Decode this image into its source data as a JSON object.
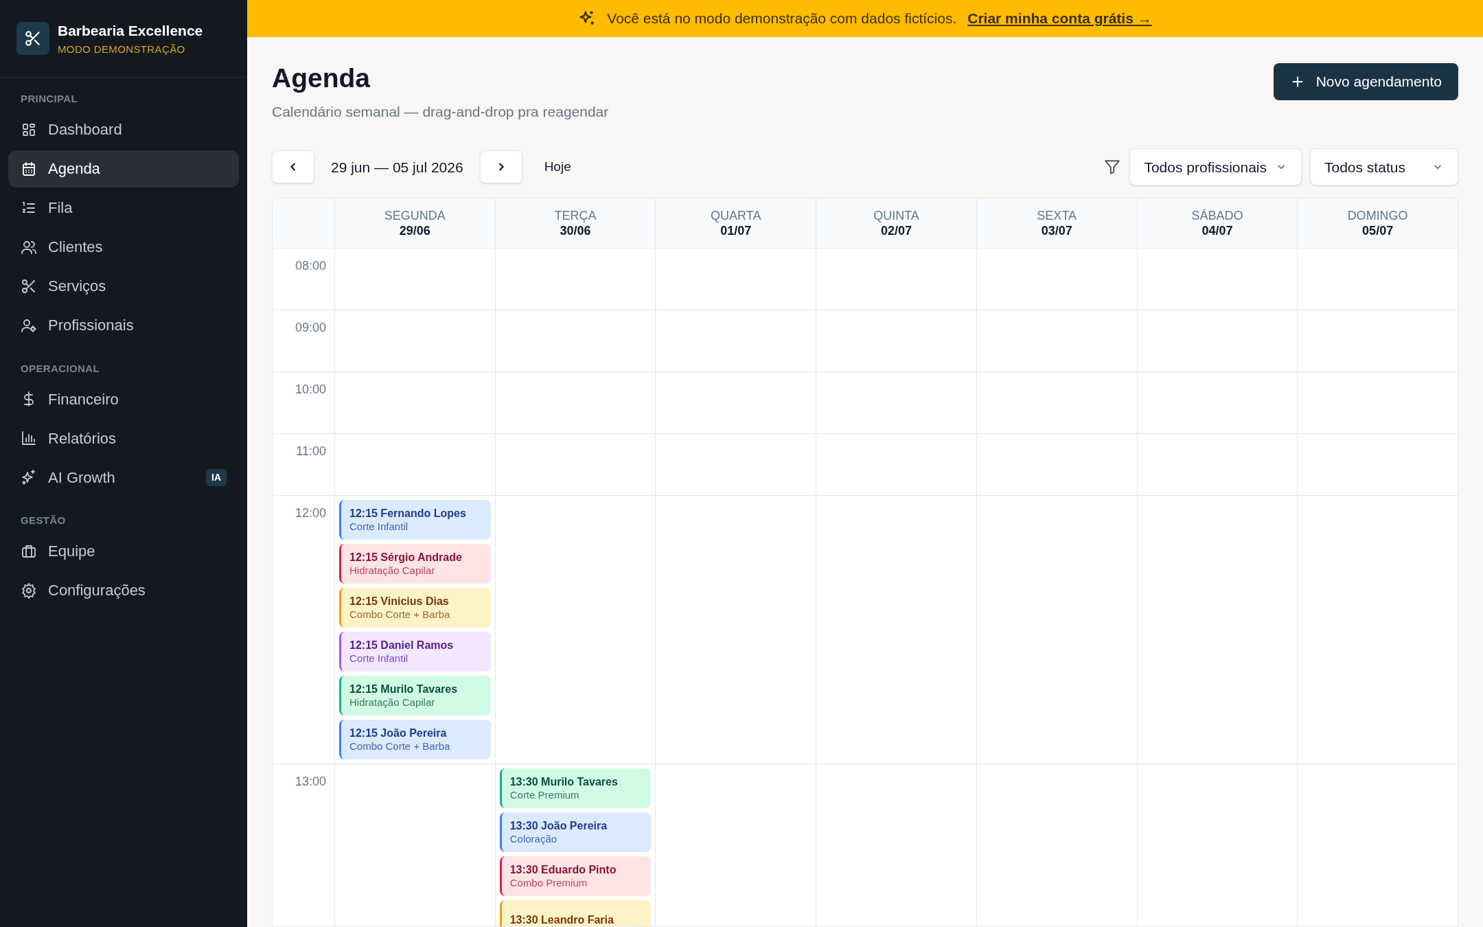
{
  "sidebar": {
    "brand": {
      "name": "Barbearia Excellence",
      "subtitle": "MODO DEMONSTRAÇÃO"
    },
    "sections": [
      {
        "title": "PRINCIPAL",
        "items": [
          {
            "label": "Dashboard",
            "selected": false
          },
          {
            "label": "Agenda",
            "selected": true
          },
          {
            "label": "Fila",
            "selected": false
          },
          {
            "label": "Clientes",
            "selected": false
          },
          {
            "label": "Serviços",
            "selected": false
          },
          {
            "label": "Profissionais",
            "selected": false
          }
        ]
      },
      {
        "title": "OPERACIONAL",
        "items": [
          {
            "label": "Financeiro",
            "selected": false
          },
          {
            "label": "Relatórios",
            "selected": false
          },
          {
            "label": "AI Growth",
            "selected": false,
            "badge": "IA"
          }
        ]
      },
      {
        "title": "GESTÃO",
        "items": [
          {
            "label": "Equipe",
            "selected": false
          },
          {
            "label": "Configurações",
            "selected": false
          }
        ]
      }
    ]
  },
  "banner": {
    "text": "Você está no modo demonstração com dados fictícios.",
    "link": "Criar minha conta grátis →"
  },
  "header": {
    "title": "Agenda",
    "subtitle": "Calendário semanal — drag-and-drop pra reagendar",
    "new_button": "Novo agendamento"
  },
  "toolbar": {
    "range": "29 jun — 05 jul 2026",
    "today": "Hoje",
    "professional_filter": "Todos profissionais",
    "status_filter": "Todos status"
  },
  "calendar": {
    "days": [
      {
        "weekday": "SEGUNDA",
        "date": "29/06"
      },
      {
        "weekday": "TERÇA",
        "date": "30/06"
      },
      {
        "weekday": "QUARTA",
        "date": "01/07"
      },
      {
        "weekday": "QUINTA",
        "date": "02/07"
      },
      {
        "weekday": "SEXTA",
        "date": "03/07"
      },
      {
        "weekday": "SÁBADO",
        "date": "04/07"
      },
      {
        "weekday": "DOMINGO",
        "date": "05/07"
      }
    ],
    "rows": [
      {
        "time": "08:00"
      },
      {
        "time": "09:00"
      },
      {
        "time": "10:00"
      },
      {
        "time": "11:00"
      },
      {
        "time": "12:00",
        "cells": [
          {
            "appointments": [
              {
                "title": "12:15 Fernando Lopes",
                "service": "Corte Infantil",
                "color": "#3b82f6"
              },
              {
                "title": "12:15 Sérgio Andrade",
                "service": "Hidratação Capilar",
                "color": "#e11d48"
              },
              {
                "title": "12:15 Vinicius Dias",
                "service": "Combo Corte + Barba",
                "color": "#f59e0b"
              },
              {
                "title": "12:15 Daniel Ramos",
                "service": "Corte Infantil",
                "color": "#a855f7"
              },
              {
                "title": "12:15 Murilo Tavares",
                "service": "Hidratação Capilar",
                "color": "#10b981"
              },
              {
                "title": "12:15 João Pereira",
                "service": "Combo Corte + Barba",
                "color": "#3b82f6"
              }
            ]
          }
        ]
      },
      {
        "time": "13:00",
        "cells": [
          {},
          {
            "appointments": [
              {
                "title": "13:30 Murilo Tavares",
                "service": "Corte Premium",
                "color": "#10b981"
              },
              {
                "title": "13:30 João Pereira",
                "service": "Coloração",
                "color": "#3b82f6"
              },
              {
                "title": "13:30 Eduardo Pinto",
                "service": "Combo Premium",
                "color": "#e11d48"
              },
              {
                "title": "13:30 Leandro Faria",
                "color": "#f59e0b"
              }
            ]
          }
        ]
      }
    ]
  }
}
